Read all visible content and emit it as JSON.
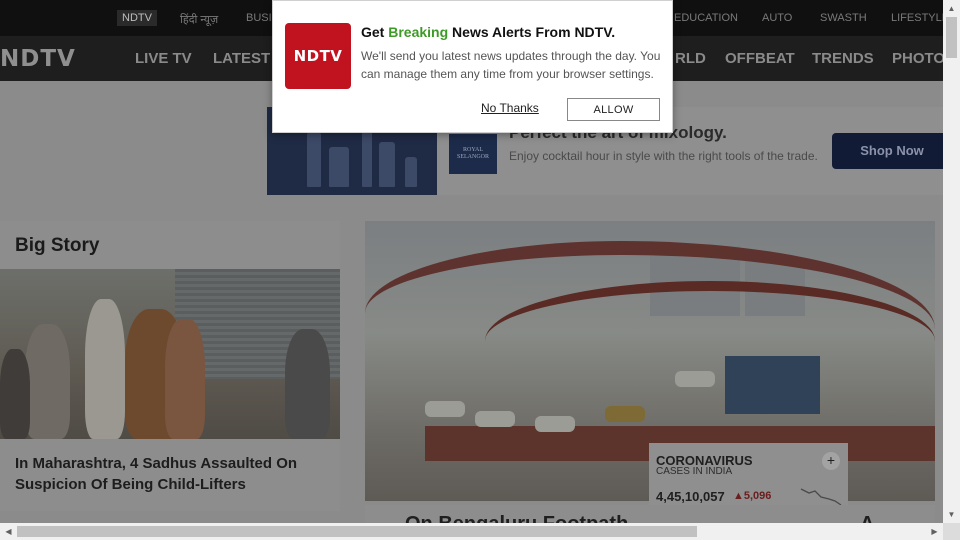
{
  "top_links": [
    {
      "label": "NDTV",
      "active": true
    },
    {
      "label": "हिंदी न्यूज़"
    },
    {
      "label": "BUSI"
    },
    {
      "label": "EDUCATION"
    },
    {
      "label": "AUTO"
    },
    {
      "label": "SWASTH"
    },
    {
      "label": "LIFESTYLE"
    }
  ],
  "logo": "NDTV",
  "nav": [
    "LIVE TV",
    "LATEST",
    "RLD",
    "OFFBEAT",
    "TRENDS",
    "PHOTO"
  ],
  "ad": {
    "brand": "ROYAL SELANGOR",
    "title": "Perfect the art of mixology.",
    "subtitle": "Enjoy cocktail hour in style with the right tools of the trade.",
    "cta": "Shop Now"
  },
  "big_story": {
    "heading": "Big Story",
    "title": "In Maharashtra, 4 Sadhus Assaulted On Suspicion Of Being Child-Lifters"
  },
  "corona": {
    "title": "CORONAVIRUS",
    "subtitle": "CASES IN INDIA",
    "count": "4,45,10,057",
    "delta": "▲5,096",
    "plus": "+"
  },
  "next_story": {
    "title_left": "On Bengaluru Footpath",
    "title_right": "A"
  },
  "popup": {
    "logo": "NDTV",
    "title_pre": "Get ",
    "title_highlight": "Breaking",
    "title_post": " News Alerts From NDTV.",
    "body": "We'll send you latest news updates through the day. You can manage them any time from your browser settings.",
    "no_thanks": "No Thanks",
    "allow": "ALLOW"
  }
}
